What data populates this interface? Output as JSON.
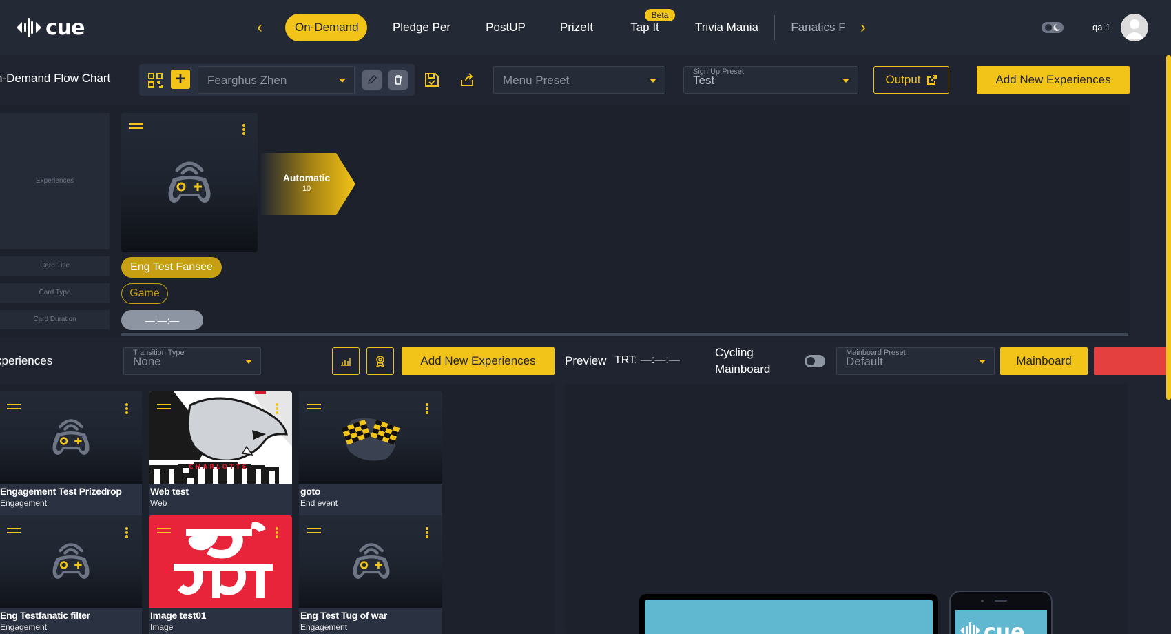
{
  "brand": {
    "logo_text": "cue",
    "accent": "#f2c318",
    "danger": "#e4403f"
  },
  "topbar": {
    "tabs": [
      {
        "label": "On-Demand",
        "active": true
      },
      {
        "label": "Pledge Per"
      },
      {
        "label": "PostUP"
      },
      {
        "label": "PrizeIt"
      },
      {
        "label": "Tap It",
        "badge": "Beta"
      },
      {
        "label": "Trivia Mania"
      },
      {
        "label": "Fanatics F"
      }
    ],
    "user": "qa-1"
  },
  "flowchart": {
    "title": "n-Demand Flow Chart",
    "presenter_select": "Fearghus Zhen",
    "menu_preset": "Menu Preset",
    "signup_preset_label": "Sign Up Preset",
    "signup_preset_value": "Test",
    "output_button": "Output",
    "add_button": "Add New Experiences",
    "row_labels": {
      "experiences": "Experiences",
      "card_title": "Card Title",
      "card_type": "Card Type",
      "card_duration": "Card Duration"
    },
    "transition": {
      "label": "Automatic",
      "duration": "10"
    },
    "card": {
      "title": "Eng Test Fansee",
      "type": "Game",
      "duration": "—:—:—"
    }
  },
  "experiences": {
    "title": "xperiences",
    "transition_label": "Transition Type",
    "transition_value": "None",
    "add_button": "Add New Experiences",
    "preview_label": "Preview",
    "trt_label": "TRT: —:—:—",
    "cycling_line1": "Cycling",
    "cycling_line2": "Mainboard",
    "mainboard_preset_label": "Mainboard Preset",
    "mainboard_preset_value": "Default",
    "mainboard_button": "Mainboard",
    "items": [
      {
        "name": "Engagement Test Prizedrop",
        "type": "Engagement",
        "thumb": "gamepad-icon"
      },
      {
        "name": "Web test",
        "type": "Web",
        "thumb": "hockey-logo"
      },
      {
        "name": "goto",
        "type": "End event",
        "thumb": "checkered-flags-icon"
      },
      {
        "name": "Eng Testfanatic filter",
        "type": "Engagement",
        "thumb": "gamepad-icon"
      },
      {
        "name": "Image test01",
        "type": "Image",
        "thumb": "bengali-text-image"
      },
      {
        "name": "Eng Test Tug of war",
        "type": "Engagement",
        "thumb": "gamepad-icon"
      }
    ]
  }
}
